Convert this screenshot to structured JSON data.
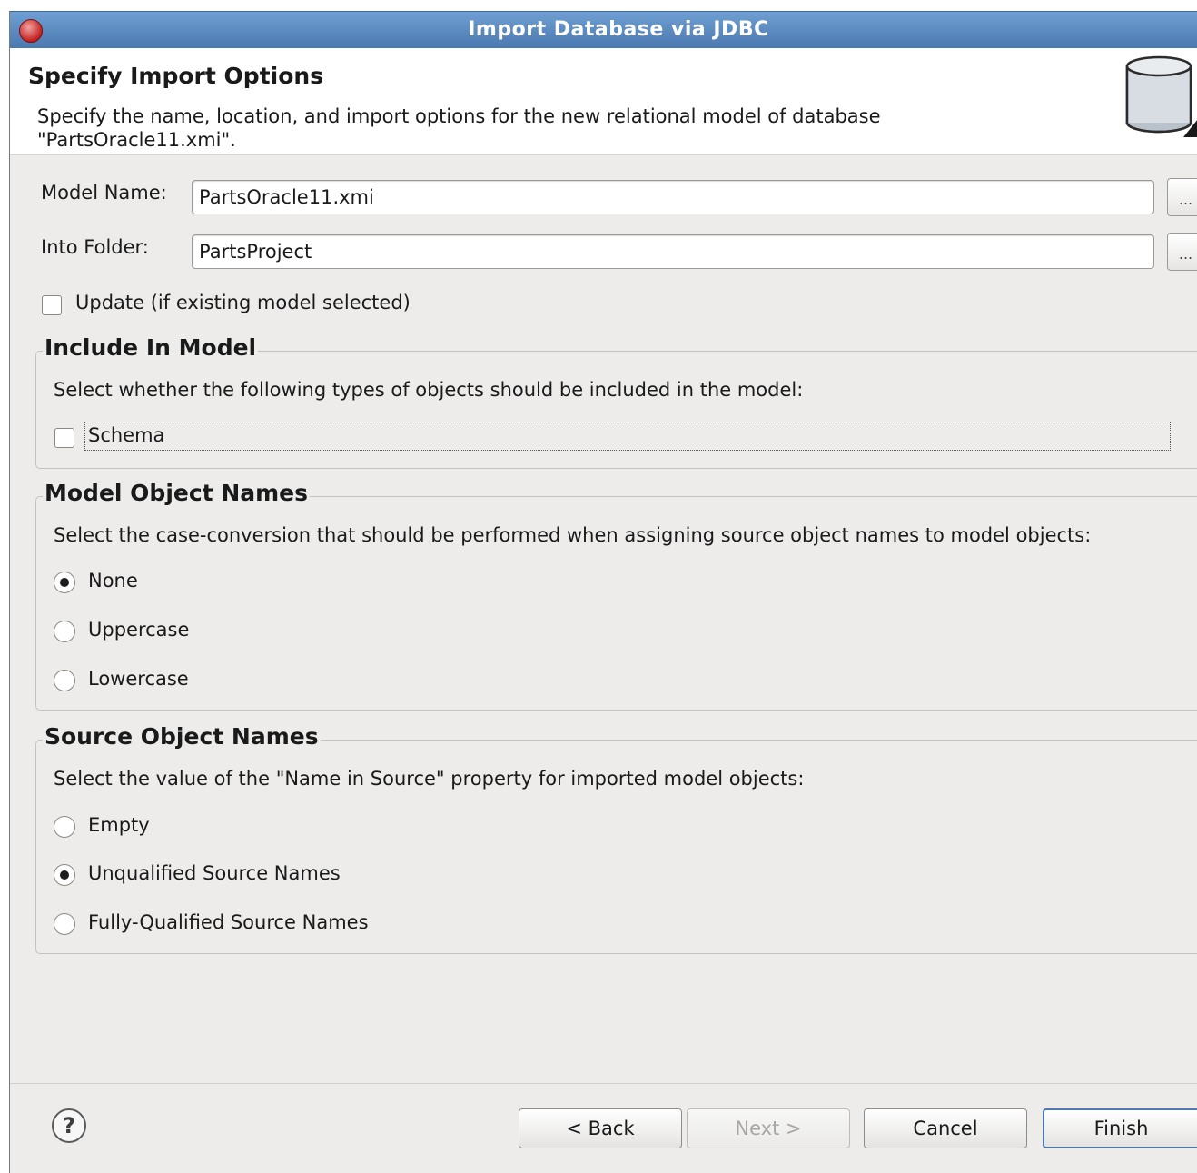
{
  "window": {
    "title": "Import Database via JDBC",
    "close_icon": "app-icon"
  },
  "banner": {
    "title": "Specify Import Options",
    "description": "Specify the name, location, and import options for the new relational model of database \"PartsOracle11.xmi\"."
  },
  "form": {
    "model_name_label": "Model Name:",
    "model_name_value": "PartsOracle11.xmi",
    "browse_label": "...",
    "into_folder_label": "Into Folder:",
    "into_folder_value": "PartsProject",
    "update_label": "Update (if existing model selected)",
    "update_checked": false
  },
  "include_group": {
    "title": "Include In Model",
    "description": "Select whether the following types of objects should be included in the model:",
    "schema_label": "Schema",
    "schema_checked": false
  },
  "names_group": {
    "title": "Model Object Names",
    "description": "Select the case-conversion that should be performed when assigning source object names to model objects:",
    "options": [
      "None",
      "Uppercase",
      "Lowercase"
    ],
    "selected": "None"
  },
  "source_group": {
    "title": "Source Object Names",
    "description": "Select the value of the \"Name in Source\" property for imported model objects:",
    "options": [
      "Empty",
      "Unqualified Source Names",
      "Fully-Qualified Source Names"
    ],
    "selected": "Unqualified Source Names"
  },
  "buttons": {
    "back": "< Back",
    "next": "Next >",
    "cancel": "Cancel",
    "finish": "Finish",
    "help": "?"
  }
}
